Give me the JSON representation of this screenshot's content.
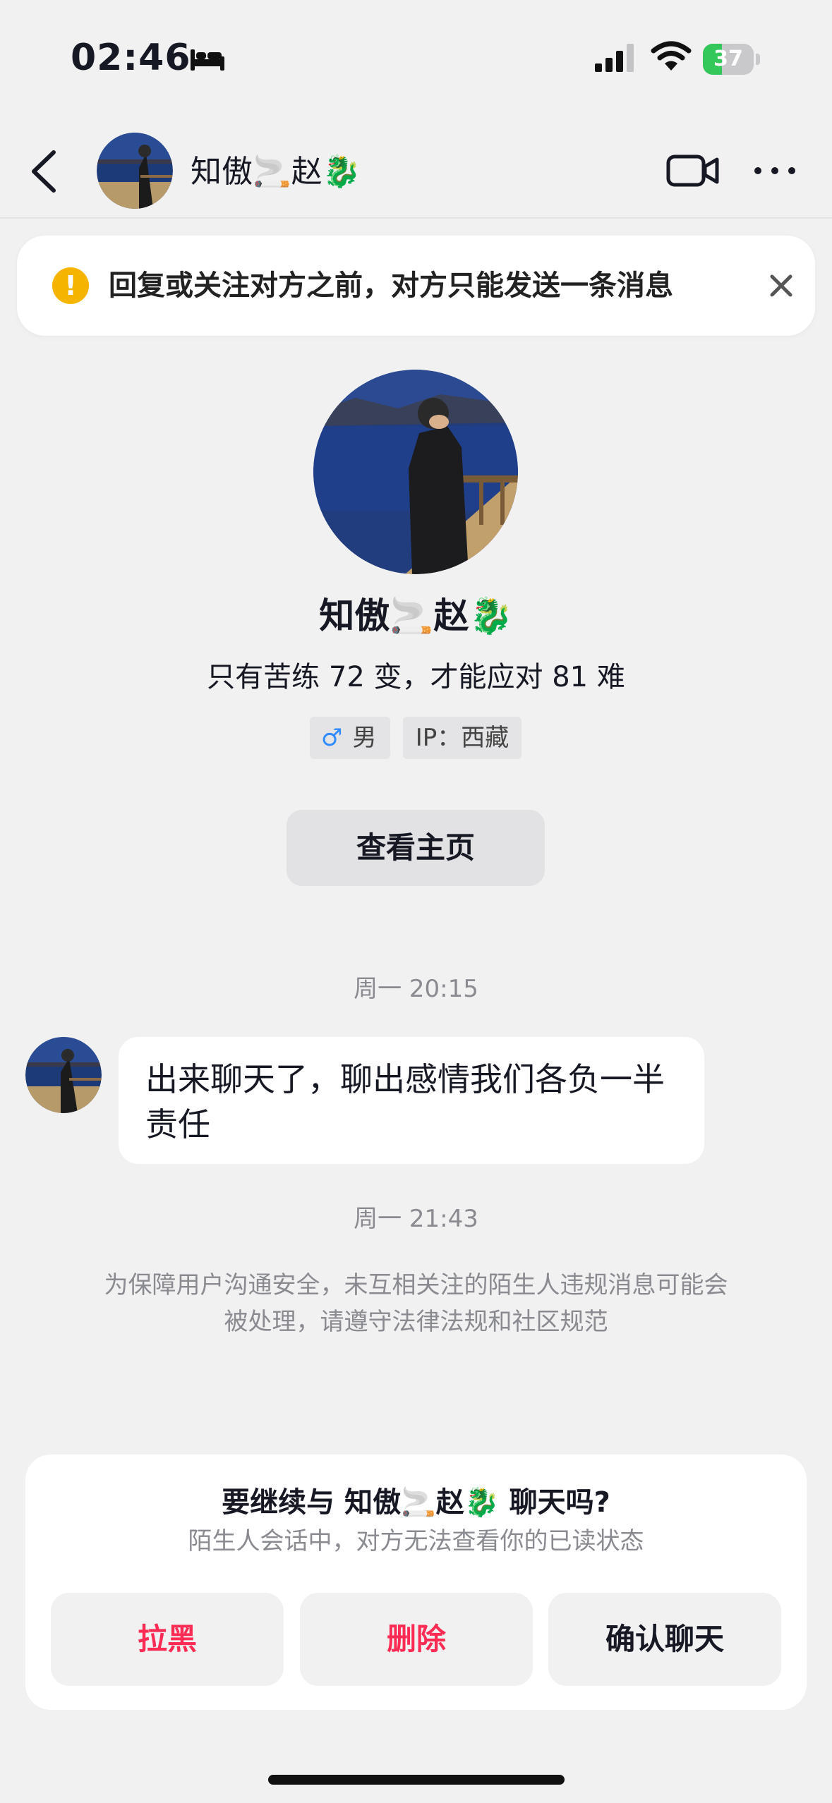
{
  "status_bar": {
    "time": "02:46",
    "battery": "37",
    "battery_level": 0.37,
    "icons": [
      "bed-icon",
      "signal-icon",
      "wifi-icon",
      "battery-charging-icon"
    ]
  },
  "nav": {
    "title": "知傲🚬赵🐉",
    "back_icon": "chevron-left-icon",
    "video_icon": "video-camera-icon",
    "more_icon": "more-dots-icon"
  },
  "notice": {
    "icon": "!",
    "text": "回复或关注对方之前，对方只能发送一条消息",
    "close_icon": "close-icon"
  },
  "profile": {
    "name": "知傲🚬赵🐉",
    "bio": "只有苦练 72 变，才能应对 81 难",
    "gender_symbol": "♂",
    "gender": "男",
    "ip": "IP：西藏",
    "homepage_button": "查看主页"
  },
  "chat": {
    "time_1": "周一 20:15",
    "message": "出来聊天了，聊出感情我们各负一半责任",
    "time_2": "周一 21:43",
    "safety_notice": "为保障用户沟通安全，未互相关注的陌生人违规消息可能会被处理，请遵守法律法规和社区规范"
  },
  "prompt_card": {
    "title": "要继续与 知傲🚬赵🐉 聊天吗?",
    "subtitle": "陌生人会话中，对方无法查看你的已读状态",
    "block_button": "拉黑",
    "delete_button": "删除",
    "confirm_button": "确认聊天"
  },
  "colors": {
    "accent_red": "#fe2c55",
    "warning_yellow": "#f5b400",
    "background": "#f1f1f2"
  }
}
